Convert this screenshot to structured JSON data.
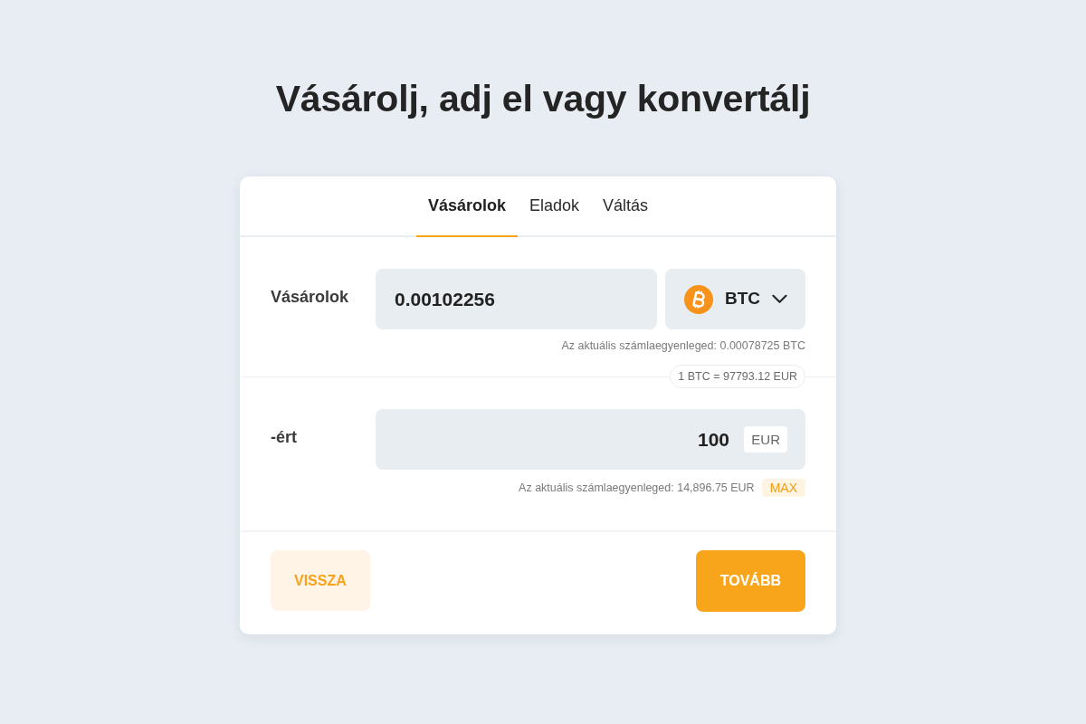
{
  "page": {
    "title": "Vásárolj, adj el vagy konvertálj"
  },
  "tabs": [
    {
      "label": "Vásárolok",
      "selected": true
    },
    {
      "label": "Eladok",
      "selected": false
    },
    {
      "label": "Váltás",
      "selected": false
    }
  ],
  "fields": [
    {
      "kind": "coin_select",
      "label": "Vásárolok",
      "value": "0.00102256",
      "currency": "BTC",
      "balance": "Az aktuális számlaegyenleged: 0.00078725 BTC"
    },
    {
      "kind": "fixed_currency",
      "label": "-ért",
      "value": "100",
      "currency": "EUR",
      "balance": "Az aktuális számlaegyenleged: 14,896.75 EUR",
      "max_label": "MAX"
    }
  ],
  "rate": "1 BTC = 97793.12 EUR",
  "buttons": {
    "back": "VISSZA",
    "next": "TOVÁBB"
  }
}
